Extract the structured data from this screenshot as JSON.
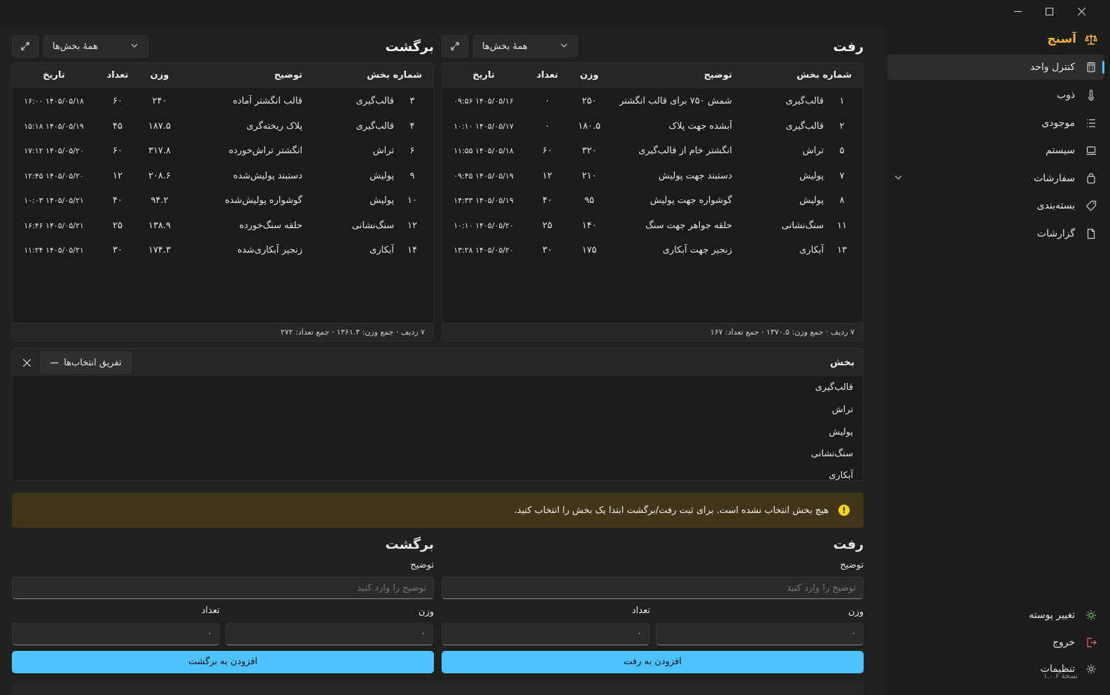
{
  "window": {
    "minimize_icon": "minimize-icon",
    "maximize_icon": "maximize-icon",
    "close_icon": "close-icon"
  },
  "sidebar": {
    "brand": "آسنج",
    "items": [
      {
        "label": "کنترل واحد",
        "icon": "calculator-icon",
        "active": true
      },
      {
        "label": "ذوب",
        "icon": "thermometer-icon"
      },
      {
        "label": "موجودی",
        "icon": "list-icon"
      },
      {
        "label": "سیستم",
        "icon": "laptop-icon"
      },
      {
        "label": "سفارشات",
        "icon": "bag-icon"
      },
      {
        "label": "بسته‌بندی",
        "icon": "tag-icon"
      },
      {
        "label": "گزارشات",
        "icon": "document-icon"
      }
    ],
    "footer": [
      {
        "label": "تغییر پوسته",
        "icon": "sun-icon"
      },
      {
        "label": "خروج",
        "icon": "logout-icon"
      },
      {
        "label": "تنظیمات",
        "icon": "gear-icon"
      }
    ],
    "version": "نسخهٔ ۱.۰.۶"
  },
  "outgoing": {
    "title": "رفت",
    "filter": "همهٔ بخش‌ها",
    "columns": [
      "شماره بخش",
      "توضیح",
      "وزن",
      "تعداد",
      "تاریخ"
    ],
    "rows": [
      [
        "۱",
        "قالب‌گیری",
        "شمش ۷۵۰ برای قالب انگشتر",
        "۲۵۰",
        "۰",
        "۱۴۰۵/۰۵/۱۶ ۰۹:۵۶"
      ],
      [
        "۲",
        "قالب‌گیری",
        "آبشده جهت پلاک",
        "۱۸۰.۵",
        "۰",
        "۱۴۰۵/۰۵/۱۷ ۱۰:۱۰"
      ],
      [
        "۵",
        "تراش",
        "انگشتر خام از قالب‌گیری",
        "۳۲۰",
        "۶۰",
        "۱۴۰۵/۰۵/۱۸ ۱۱:۵۵"
      ],
      [
        "۷",
        "پولیش",
        "دستبند جهت پولیش",
        "۲۱۰",
        "۱۲",
        "۱۴۰۵/۰۵/۱۹ ۰۹:۴۵"
      ],
      [
        "۸",
        "پولیش",
        "گوشواره جهت پولیش",
        "۹۵",
        "۴۰",
        "۱۴۰۵/۰۵/۱۹ ۱۴:۳۳"
      ],
      [
        "۱۱",
        "سنگ‌نشانی",
        "حلقه جواهر جهت سنگ",
        "۱۴۰",
        "۲۵",
        "۱۴۰۵/۰۵/۲۰ ۱۰:۱۰"
      ],
      [
        "۱۳",
        "آبکاری",
        "زنجیر جهت آبکاری",
        "۱۷۵",
        "۳۰",
        "۱۴۰۵/۰۵/۲۰ ۱۳:۲۸"
      ]
    ],
    "footer": "۷ ردیف · جمع وزن: ۱۳۷۰.۵ · جمع تعداد: ۱۶۷"
  },
  "returning": {
    "title": "برگشت",
    "filter": "همهٔ بخش‌ها",
    "columns": [
      "شماره بخش",
      "توضیح",
      "وزن",
      "تعداد",
      "تاریخ"
    ],
    "rows": [
      [
        "۳",
        "قالب‌گیری",
        "قالب انگشتر آماده",
        "۲۴۰",
        "۶۰",
        "۱۴۰۵/۰۵/۱۸ ۱۶:۰۰"
      ],
      [
        "۴",
        "قالب‌گیری",
        "پلاک ریخته‌گری",
        "۱۸۷.۵",
        "۴۵",
        "۱۴۰۵/۰۵/۱۹ ۱۵:۱۸"
      ],
      [
        "۶",
        "تراش",
        "انگشتر تراش‌خورده",
        "۳۱۷.۸",
        "۶۰",
        "۱۴۰۵/۰۵/۲۰ ۱۷:۱۲"
      ],
      [
        "۹",
        "پولیش",
        "دستبند پولیش‌شده",
        "۲۰۸.۶",
        "۱۲",
        "۱۴۰۵/۰۵/۲۰ ۱۲:۴۵"
      ],
      [
        "۱۰",
        "پولیش",
        "گوشواره پولیش‌شده",
        "۹۴.۲",
        "۴۰",
        "۱۴۰۵/۰۵/۲۱ ۱۰:۰۳"
      ],
      [
        "۱۲",
        "سنگ‌نشانی",
        "حلقه سنگ‌خورده",
        "۱۳۸.۹",
        "۲۵",
        "۱۴۰۵/۰۵/۲۱ ۱۶:۴۶"
      ],
      [
        "۱۴",
        "آبکاری",
        "زنجیر آبکاری‌شده",
        "۱۷۴.۳",
        "۳۰",
        "۱۴۰۵/۰۵/۲۱ ۱۱:۲۴"
      ]
    ],
    "footer": "۷ ردیف · جمع وزن: ۱۳۶۱.۳ · جمع تعداد: ۲۷۲"
  },
  "sections": {
    "title": "بخش",
    "clear_label": "تفریق انتخاب‌ها",
    "items": [
      "قالب‌گیری",
      "تراش",
      "پولیش",
      "سنگ‌نشانی",
      "آبکاری"
    ]
  },
  "warning": {
    "text": "هیچ بخش انتخاب نشده است. برای ثبت رفت/برگشت ابتدا یک بخش را انتخاب کنید.",
    "color": "#433519"
  },
  "form_out": {
    "title": "رفت",
    "desc_label": "توضیح",
    "desc_placeholder": "توضیح را وارد کنید",
    "weight_label": "وزن",
    "weight_value": "۰",
    "count_label": "تعداد",
    "count_value": "۰",
    "button": "افزودن به رفت"
  },
  "form_back": {
    "title": "برگشت",
    "desc_label": "توضیح",
    "desc_placeholder": "توضیح را وارد کنید",
    "weight_label": "وزن",
    "weight_value": "۰",
    "count_label": "تعداد",
    "count_value": "۰",
    "button": "افزودن به برگشت"
  },
  "colors": {
    "accent": "#4cc2ff",
    "brand": "#f0b429",
    "warning_icon": "#f5d90a"
  }
}
